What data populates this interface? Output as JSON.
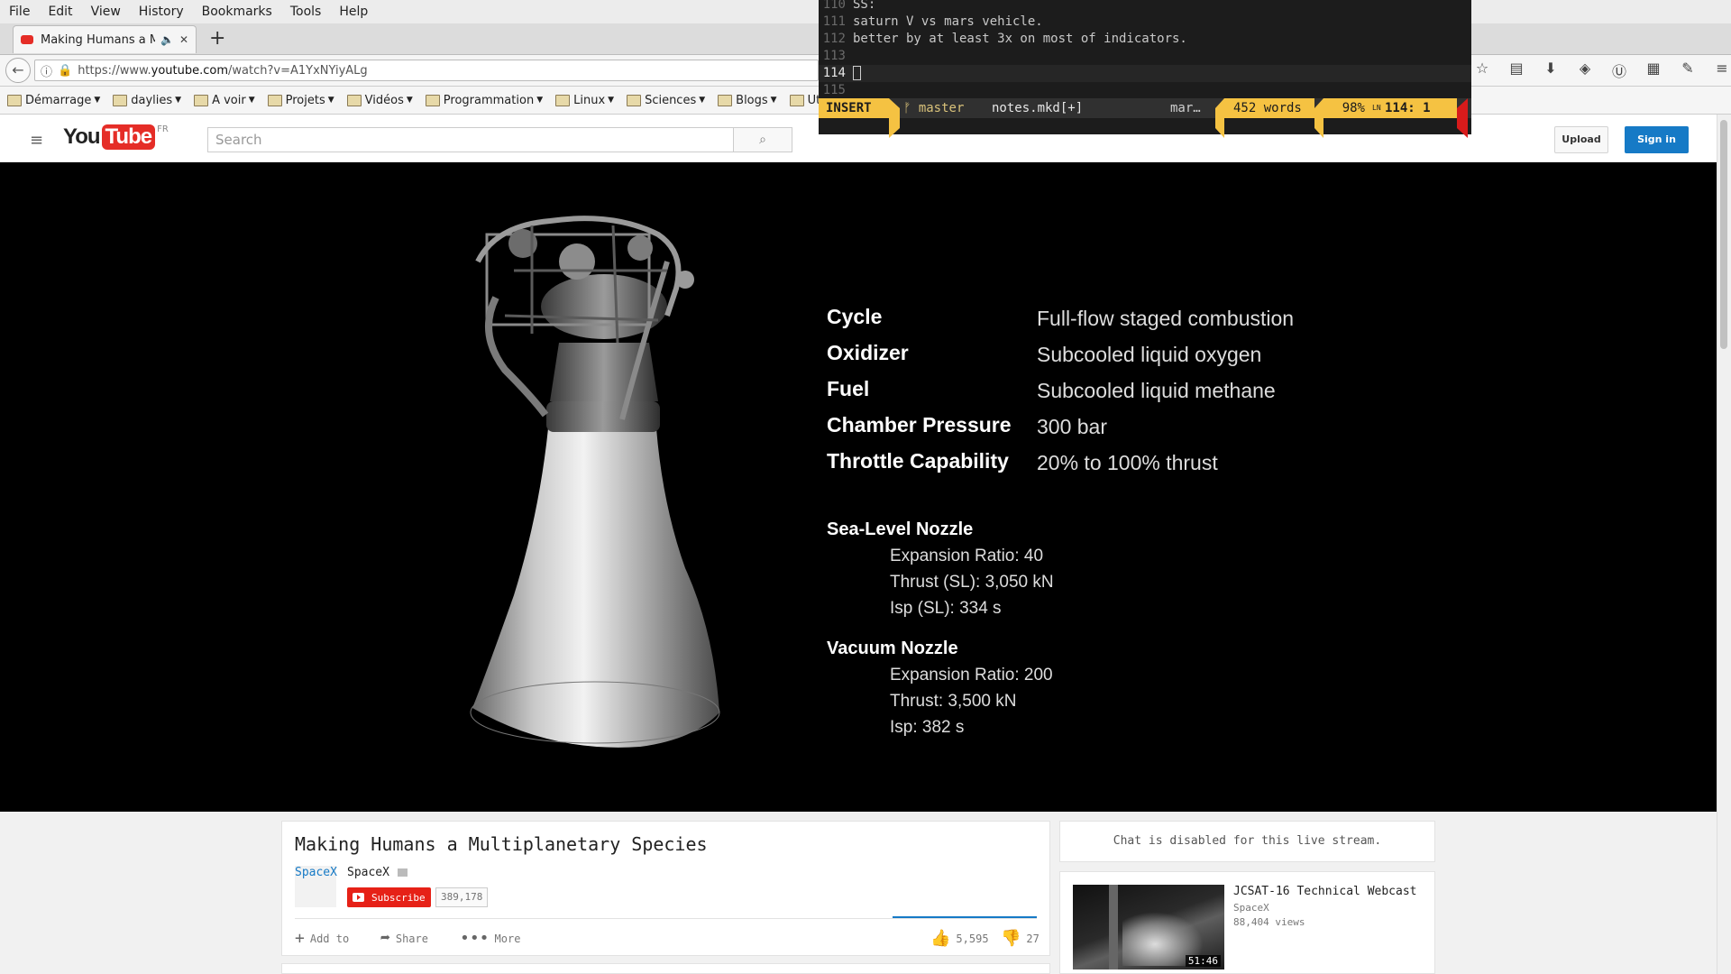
{
  "menu": [
    "File",
    "Edit",
    "View",
    "History",
    "Bookmarks",
    "Tools",
    "Help"
  ],
  "tab": {
    "title": "Making Humans a M...",
    "new_tab": "+"
  },
  "nav": {
    "url_prefix": "https://www.",
    "url_host": "youtube.com",
    "url_path": "/watch?v=A1YxNYiyALg"
  },
  "bookmarks": [
    "Démarrage",
    "daylies",
    "A voir",
    "Projets",
    "Vidéos",
    "Programmation",
    "Linux",
    "Sciences",
    "Blogs",
    "Utili"
  ],
  "youtube": {
    "logo_you": "You",
    "logo_tube": "Tube",
    "logo_region": "FR",
    "search_placeholder": "Search",
    "upload_label": "Upload",
    "signin_label": "Sign in"
  },
  "video_slide": {
    "specs": [
      {
        "label": "Cycle",
        "value": "Full-flow staged combustion"
      },
      {
        "label": "Oxidizer",
        "value": "Subcooled liquid oxygen"
      },
      {
        "label": "Fuel",
        "value": "Subcooled liquid methane"
      },
      {
        "label": "Chamber Pressure",
        "value": "300 bar"
      },
      {
        "label": "Throttle Capability",
        "value": "20% to 100% thrust"
      }
    ],
    "sea_level": {
      "heading": "Sea-Level Nozzle",
      "lines": [
        "Expansion Ratio: 40",
        "Thrust (SL): 3,050 kN",
        "Isp (SL): 334 s"
      ]
    },
    "vacuum": {
      "heading": "Vacuum Nozzle",
      "lines": [
        "Expansion Ratio: 200",
        "Thrust: 3,500 kN",
        "Isp: 382 s"
      ]
    }
  },
  "video_info": {
    "title": "Making Humans a Multiplanetary Species",
    "channel_link": "SpaceX",
    "channel_name": "SpaceX",
    "subscribe_label": "Subscribe",
    "subscriber_count": "389,178",
    "actions": {
      "add_to": "Add to",
      "share": "Share",
      "more": "More"
    },
    "likes": "5,595",
    "dislikes": "27"
  },
  "sidebar": {
    "chat_disabled": "Chat is disabled for this live stream.",
    "related": {
      "title": "JCSAT-16 Technical Webcast",
      "channel": "SpaceX",
      "views": "88,404 views",
      "duration": "51:46"
    }
  },
  "terminal": {
    "lines": [
      {
        "num": "110",
        "text": "SS:"
      },
      {
        "num": "111",
        "text": "saturn V vs mars vehicle."
      },
      {
        "num": "112",
        "text": "better by at least 3x on most of indicators."
      },
      {
        "num": "113",
        "text": ""
      },
      {
        "num": "114",
        "text": ""
      },
      {
        "num": "115",
        "text": ""
      }
    ],
    "status": {
      "mode": "INSERT",
      "branch": "ᚠ master",
      "file": "notes.mkd[+]",
      "truncated": "mar…",
      "words": "452 words",
      "percent": "98%",
      "ln_mark": "LN",
      "position": "114:  1"
    }
  },
  "colors": {
    "youtube_red": "#e52d27",
    "youtube_blue": "#167ac6",
    "vim_accent": "#f5c242"
  }
}
